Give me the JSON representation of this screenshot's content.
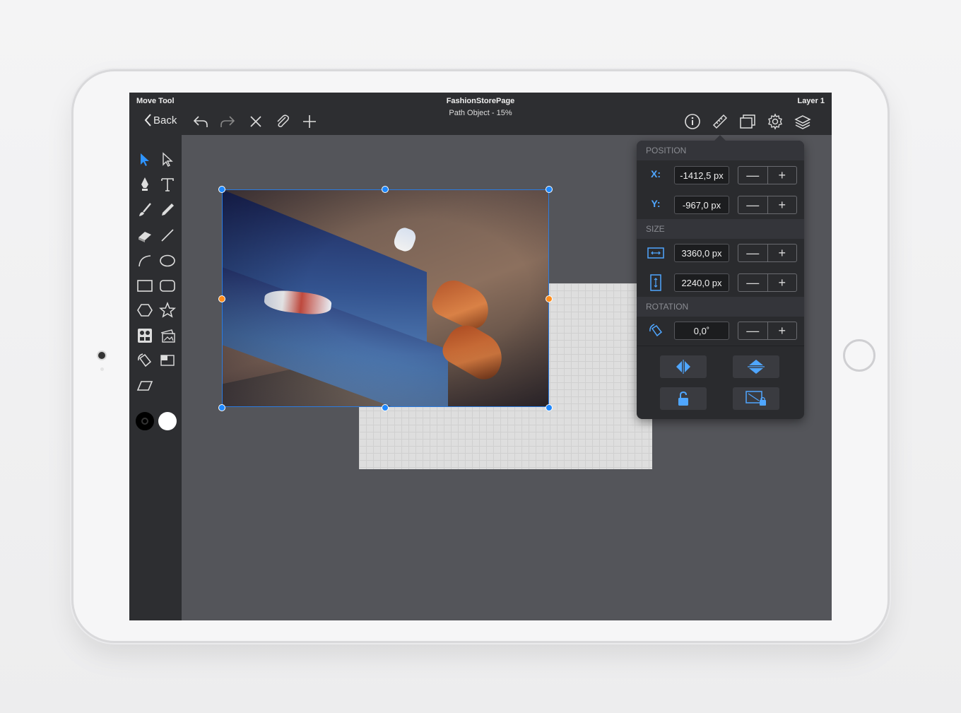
{
  "header": {
    "tool_label": "Move Tool",
    "doc_title": "FashionStorePage",
    "doc_subtitle": "Path Object - 15%",
    "layer_label": "Layer 1",
    "back_label": "Back"
  },
  "colors": {
    "accent": "#4fa6ff",
    "handle": "#1e88ff",
    "handle_mid": "#ff8c1a",
    "toolbar_bg": "#2d2e31",
    "canvas_bg": "#54555a"
  },
  "toolbar_icons": [
    "undo-icon",
    "redo-icon",
    "close-icon",
    "paperclip-icon",
    "plus-icon",
    "info-icon",
    "ruler-icon",
    "window-icon",
    "gear-icon",
    "layers-icon"
  ],
  "tools": [
    "move-tool-icon",
    "direct-select-tool-icon",
    "pen-tool-icon",
    "text-tool-icon",
    "brush-tool-icon",
    "pencil-tool-icon",
    "eraser-tool-icon",
    "line-tool-icon",
    "arc-tool-icon",
    "ellipse-tool-icon",
    "rectangle-tool-icon",
    "rounded-rect-tool-icon",
    "hexagon-tool-icon",
    "star-tool-icon",
    "image-grid-tool-icon",
    "image-import-tool-icon",
    "rotate-tool-icon",
    "resize-tool-icon",
    "skew-tool-icon"
  ],
  "panel": {
    "position": {
      "heading": "POSITION",
      "x_label": "X:",
      "x_value": "-1412,5 px",
      "y_label": "Y:",
      "y_value": "-967,0 px"
    },
    "size": {
      "heading": "SIZE",
      "width_value": "3360,0 px",
      "height_value": "2240,0 px"
    },
    "rotation": {
      "heading": "ROTATION",
      "value": "0,0˚"
    },
    "stepper": {
      "minus": "—",
      "plus": "+"
    },
    "actions": [
      "flip-horizontal-icon",
      "flip-vertical-icon",
      "unlock-icon",
      "lock-aspect-icon"
    ]
  }
}
